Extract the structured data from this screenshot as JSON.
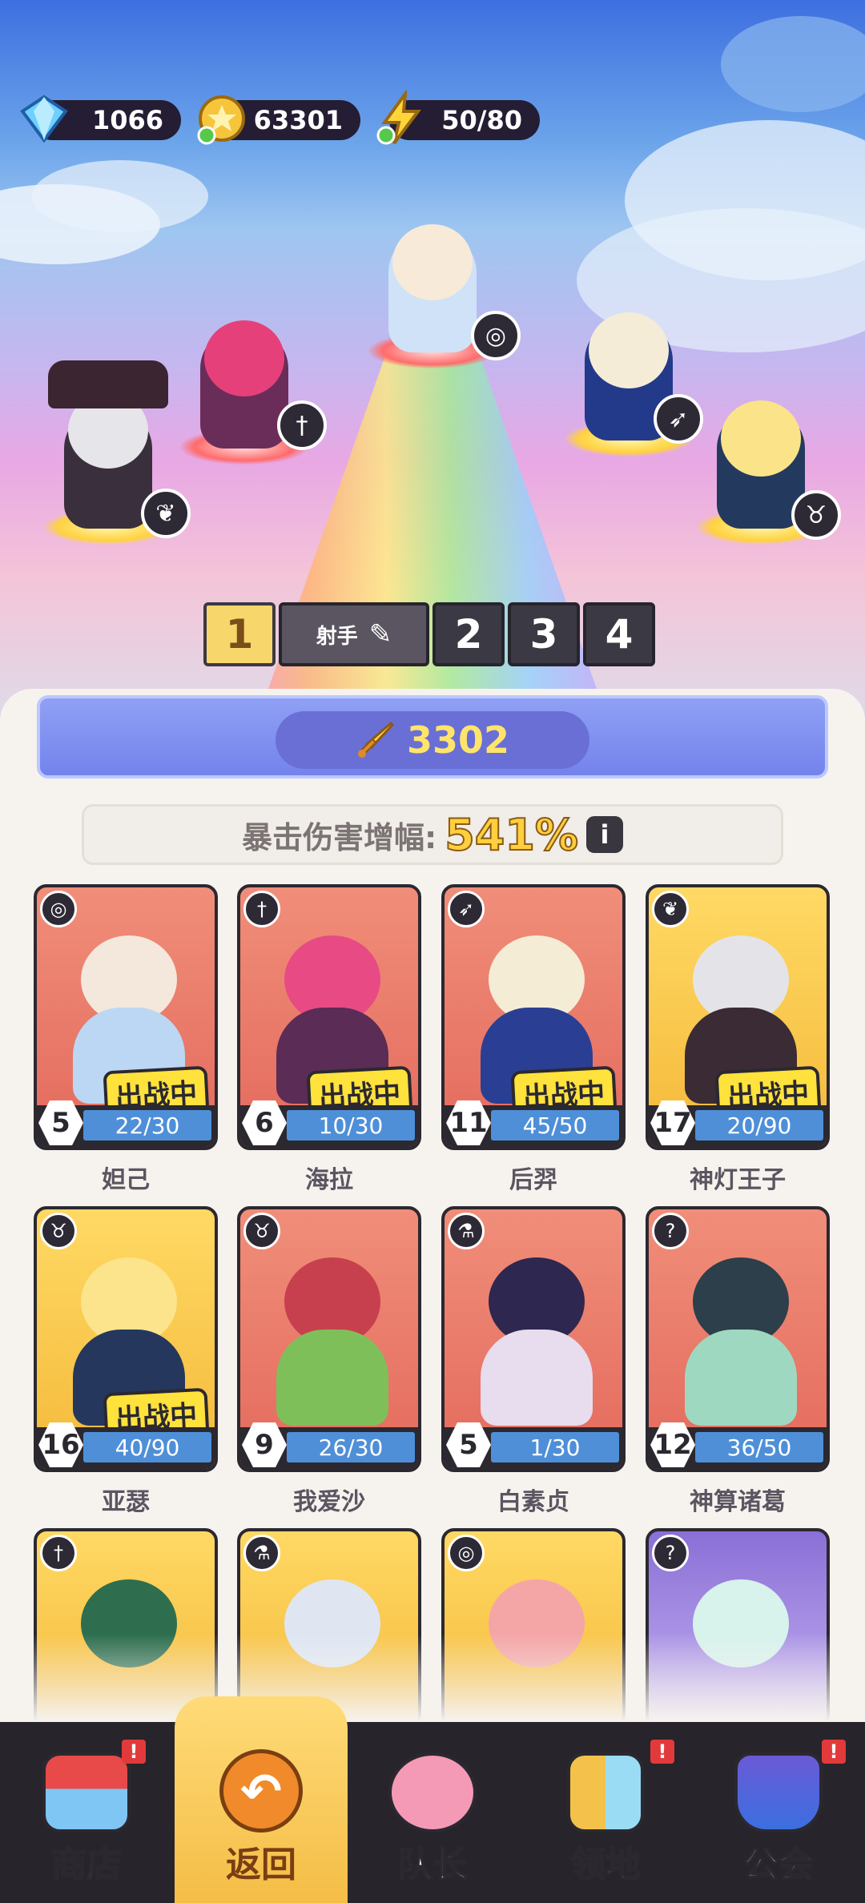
{
  "currency": {
    "gems": "1066",
    "coins": "63301",
    "energy": "50/80"
  },
  "team_tabs": [
    {
      "label": "1"
    },
    {
      "label": "射手"
    },
    {
      "label": "2"
    },
    {
      "label": "3"
    },
    {
      "label": "4"
    }
  ],
  "power": "3302",
  "crit": {
    "label": "暴击伤害增幅:",
    "value": "541%",
    "info": "i"
  },
  "deploy_label": "出战中",
  "heroes": [
    {
      "name": "妲己",
      "level": "5",
      "progress": "22/30",
      "class_icon": "spiral-icon",
      "deployed": true
    },
    {
      "name": "海拉",
      "level": "6",
      "progress": "10/30",
      "class_icon": "sword-icon",
      "deployed": true
    },
    {
      "name": "后羿",
      "level": "11",
      "progress": "45/50",
      "class_icon": "bow-icon",
      "deployed": true
    },
    {
      "name": "神灯王子",
      "level": "17",
      "progress": "20/90",
      "class_icon": "wings-icon",
      "deployed": true
    },
    {
      "name": "亚瑟",
      "level": "16",
      "progress": "40/90",
      "class_icon": "ox-icon",
      "deployed": true
    },
    {
      "name": "我爱沙",
      "level": "9",
      "progress": "26/30",
      "class_icon": "ox-icon",
      "deployed": false
    },
    {
      "name": "白素贞",
      "level": "5",
      "progress": "1/30",
      "class_icon": "potion-icon",
      "deployed": false
    },
    {
      "name": "神算诸葛",
      "level": "12",
      "progress": "36/50",
      "class_icon": "question-icon",
      "deployed": false
    }
  ],
  "partial_cards": [
    {
      "class_icon": "sword-icon"
    },
    {
      "class_icon": "potion-icon"
    },
    {
      "class_icon": "spiral-icon"
    },
    {
      "class_icon": "question-icon"
    }
  ],
  "nav": [
    {
      "label": "商店",
      "badge": "!"
    },
    {
      "label": "返回"
    },
    {
      "label": "队长"
    },
    {
      "label": "领地",
      "badge": "!"
    },
    {
      "label": "公会",
      "badge": "!"
    }
  ]
}
